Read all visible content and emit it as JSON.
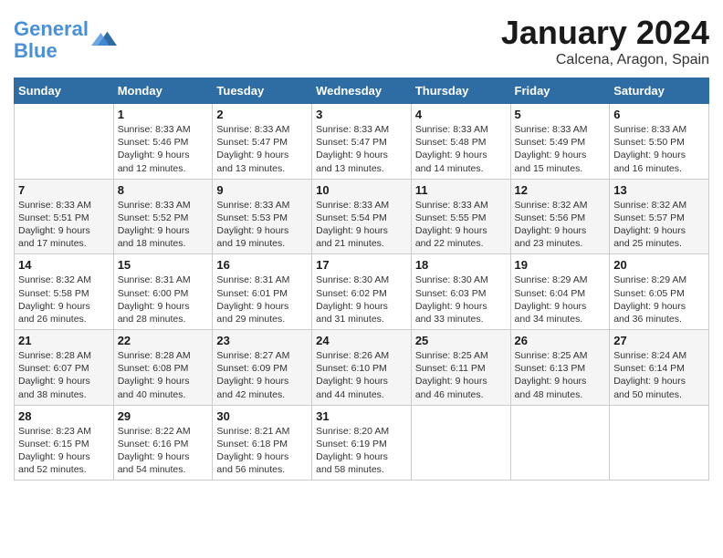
{
  "header": {
    "logo_line1": "General",
    "logo_line2": "Blue",
    "month": "January 2024",
    "location": "Calcena, Aragon, Spain"
  },
  "columns": [
    "Sunday",
    "Monday",
    "Tuesday",
    "Wednesday",
    "Thursday",
    "Friday",
    "Saturday"
  ],
  "weeks": [
    [
      {
        "day": "",
        "info": ""
      },
      {
        "day": "1",
        "info": "Sunrise: 8:33 AM\nSunset: 5:46 PM\nDaylight: 9 hours\nand 12 minutes."
      },
      {
        "day": "2",
        "info": "Sunrise: 8:33 AM\nSunset: 5:47 PM\nDaylight: 9 hours\nand 13 minutes."
      },
      {
        "day": "3",
        "info": "Sunrise: 8:33 AM\nSunset: 5:47 PM\nDaylight: 9 hours\nand 13 minutes."
      },
      {
        "day": "4",
        "info": "Sunrise: 8:33 AM\nSunset: 5:48 PM\nDaylight: 9 hours\nand 14 minutes."
      },
      {
        "day": "5",
        "info": "Sunrise: 8:33 AM\nSunset: 5:49 PM\nDaylight: 9 hours\nand 15 minutes."
      },
      {
        "day": "6",
        "info": "Sunrise: 8:33 AM\nSunset: 5:50 PM\nDaylight: 9 hours\nand 16 minutes."
      }
    ],
    [
      {
        "day": "7",
        "info": "Sunrise: 8:33 AM\nSunset: 5:51 PM\nDaylight: 9 hours\nand 17 minutes."
      },
      {
        "day": "8",
        "info": "Sunrise: 8:33 AM\nSunset: 5:52 PM\nDaylight: 9 hours\nand 18 minutes."
      },
      {
        "day": "9",
        "info": "Sunrise: 8:33 AM\nSunset: 5:53 PM\nDaylight: 9 hours\nand 19 minutes."
      },
      {
        "day": "10",
        "info": "Sunrise: 8:33 AM\nSunset: 5:54 PM\nDaylight: 9 hours\nand 21 minutes."
      },
      {
        "day": "11",
        "info": "Sunrise: 8:33 AM\nSunset: 5:55 PM\nDaylight: 9 hours\nand 22 minutes."
      },
      {
        "day": "12",
        "info": "Sunrise: 8:32 AM\nSunset: 5:56 PM\nDaylight: 9 hours\nand 23 minutes."
      },
      {
        "day": "13",
        "info": "Sunrise: 8:32 AM\nSunset: 5:57 PM\nDaylight: 9 hours\nand 25 minutes."
      }
    ],
    [
      {
        "day": "14",
        "info": "Sunrise: 8:32 AM\nSunset: 5:58 PM\nDaylight: 9 hours\nand 26 minutes."
      },
      {
        "day": "15",
        "info": "Sunrise: 8:31 AM\nSunset: 6:00 PM\nDaylight: 9 hours\nand 28 minutes."
      },
      {
        "day": "16",
        "info": "Sunrise: 8:31 AM\nSunset: 6:01 PM\nDaylight: 9 hours\nand 29 minutes."
      },
      {
        "day": "17",
        "info": "Sunrise: 8:30 AM\nSunset: 6:02 PM\nDaylight: 9 hours\nand 31 minutes."
      },
      {
        "day": "18",
        "info": "Sunrise: 8:30 AM\nSunset: 6:03 PM\nDaylight: 9 hours\nand 33 minutes."
      },
      {
        "day": "19",
        "info": "Sunrise: 8:29 AM\nSunset: 6:04 PM\nDaylight: 9 hours\nand 34 minutes."
      },
      {
        "day": "20",
        "info": "Sunrise: 8:29 AM\nSunset: 6:05 PM\nDaylight: 9 hours\nand 36 minutes."
      }
    ],
    [
      {
        "day": "21",
        "info": "Sunrise: 8:28 AM\nSunset: 6:07 PM\nDaylight: 9 hours\nand 38 minutes."
      },
      {
        "day": "22",
        "info": "Sunrise: 8:28 AM\nSunset: 6:08 PM\nDaylight: 9 hours\nand 40 minutes."
      },
      {
        "day": "23",
        "info": "Sunrise: 8:27 AM\nSunset: 6:09 PM\nDaylight: 9 hours\nand 42 minutes."
      },
      {
        "day": "24",
        "info": "Sunrise: 8:26 AM\nSunset: 6:10 PM\nDaylight: 9 hours\nand 44 minutes."
      },
      {
        "day": "25",
        "info": "Sunrise: 8:25 AM\nSunset: 6:11 PM\nDaylight: 9 hours\nand 46 minutes."
      },
      {
        "day": "26",
        "info": "Sunrise: 8:25 AM\nSunset: 6:13 PM\nDaylight: 9 hours\nand 48 minutes."
      },
      {
        "day": "27",
        "info": "Sunrise: 8:24 AM\nSunset: 6:14 PM\nDaylight: 9 hours\nand 50 minutes."
      }
    ],
    [
      {
        "day": "28",
        "info": "Sunrise: 8:23 AM\nSunset: 6:15 PM\nDaylight: 9 hours\nand 52 minutes."
      },
      {
        "day": "29",
        "info": "Sunrise: 8:22 AM\nSunset: 6:16 PM\nDaylight: 9 hours\nand 54 minutes."
      },
      {
        "day": "30",
        "info": "Sunrise: 8:21 AM\nSunset: 6:18 PM\nDaylight: 9 hours\nand 56 minutes."
      },
      {
        "day": "31",
        "info": "Sunrise: 8:20 AM\nSunset: 6:19 PM\nDaylight: 9 hours\nand 58 minutes."
      },
      {
        "day": "",
        "info": ""
      },
      {
        "day": "",
        "info": ""
      },
      {
        "day": "",
        "info": ""
      }
    ]
  ]
}
